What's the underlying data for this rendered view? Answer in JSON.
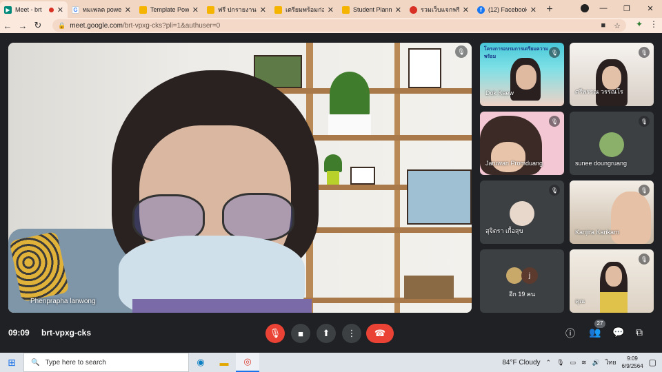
{
  "browser": {
    "tabs": [
      {
        "label": "Meet - brt",
        "active": true,
        "favicon": "meet-icon",
        "recording": true
      },
      {
        "label": "ทมเพลต power",
        "favicon": "slides-icon"
      },
      {
        "label": "Template Pow",
        "favicon": "slides-icon"
      },
      {
        "label": "ฟรี ปกรายงาน",
        "favicon": "slides-icon"
      },
      {
        "label": "เตรียมพร้อมก่อน",
        "favicon": "slides-icon"
      },
      {
        "label": "Student Plann",
        "favicon": "slides-icon"
      },
      {
        "label": "รวมเว็บแจกฟรี",
        "favicon": "red-globe-icon"
      },
      {
        "label": "(12) Facebook",
        "favicon": "facebook-icon"
      }
    ],
    "new_tab": "+",
    "url_host": "meet.google.com",
    "url_path": "/brt-vpxg-cks?pli=1&authuser=0"
  },
  "meet": {
    "presenter": {
      "name": "Phenprapha lanwong"
    },
    "tiles": [
      {
        "name": "Dok Kaew",
        "banner": "โครงการอบรมการเตรียมความพร้อม"
      },
      {
        "name": "ศรีพรรณ วรรณโร"
      },
      {
        "name": "Jaruwan Promduang"
      },
      {
        "name": "sunee doungruang"
      },
      {
        "name": "สุจิตรา เกื้อสุข"
      },
      {
        "name": "Kanjira Karikarn"
      },
      {
        "name": "อีก 19 คน",
        "avatar_letter": "j"
      },
      {
        "name": "คุณ"
      }
    ],
    "time": "09:09",
    "meeting_code": "brt-vpxg-cks",
    "participant_count": "27"
  },
  "taskbar": {
    "search_placeholder": "Type here to search",
    "weather": "84°F  Cloudy",
    "lang": "ไทย",
    "time": "9:09",
    "date": "6/9/2564"
  }
}
